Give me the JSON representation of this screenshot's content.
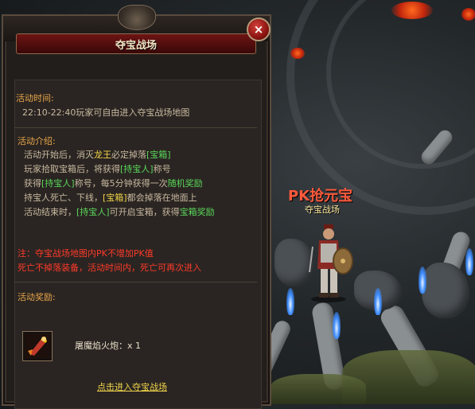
{
  "scene": {
    "hero_name": "PK抢元宝",
    "hero_subtitle": "夺宝战场",
    "accent_colors": {
      "hero_name": "#ff5a3c",
      "hero_subtitle": "#ffe9a0",
      "flame": "#3d8cff"
    }
  },
  "panel": {
    "title": "夺宝战场",
    "close_icon": "×",
    "time_section": {
      "title": "活动时间:",
      "text": "22:10-22:40玩家可自由进入夺宝战场地图"
    },
    "intro_section": {
      "title": "活动介绍:",
      "lines": [
        {
          "p1": "活动开始后，消灭",
          "h1": "龙王",
          "p2": "必定掉落",
          "h2": "[宝箱]",
          "p3": ""
        },
        {
          "p1": "玩家拾取宝箱后，将获得",
          "h1": "[持宝人]",
          "p2": "称号",
          "h2": "",
          "p3": ""
        },
        {
          "p1": "获得",
          "h1": "[持宝人]",
          "p2": "称号，每5分钟获得一次",
          "h2": "随机奖励",
          "p3": ""
        },
        {
          "p1": "持宝人死亡、下线，",
          "h1": "[宝箱]",
          "p2": "都会掉落在地面上",
          "h2": "",
          "p3": ""
        },
        {
          "p1": "活动结束时，",
          "h1": "[持宝人]",
          "p2": "可开启宝箱，获得",
          "h2": "宝箱奖励",
          "p3": ""
        }
      ]
    },
    "notice": {
      "line1": "注：夺宝战场地图内PK不增加PK值",
      "line2": "死亡不掉落装备，活动时间内，死亡可再次进入"
    },
    "reward_section": {
      "title": "活动奖励:",
      "item_icon": "flame-cannon-icon",
      "item_name": "屠魔焰火炮：x 1"
    },
    "enter_link": "点击进入夺宝战场"
  }
}
